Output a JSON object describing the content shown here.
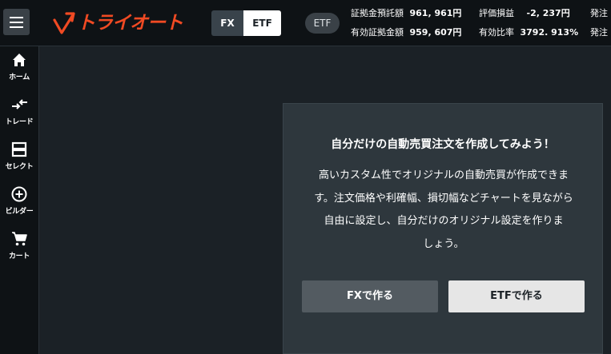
{
  "header": {
    "logo_text": "トライオート",
    "segment": {
      "fx_label": "FX",
      "etf_label": "ETF",
      "selected": "ETF"
    },
    "mode_pill": "ETF",
    "stats": {
      "row1": [
        {
          "label": "証拠金預託額",
          "value": "961, 961円"
        },
        {
          "label": "評価損益",
          "value": "-2, 237円"
        },
        {
          "label": "発注",
          "value": ""
        }
      ],
      "row2": [
        {
          "label": "有効証拠金額",
          "value": "959, 607円"
        },
        {
          "label": "有効比率",
          "value": "3792. 913%"
        },
        {
          "label": "発注",
          "value": ""
        }
      ]
    }
  },
  "sidebar": {
    "items": [
      {
        "label": "ホーム",
        "icon": "home-icon"
      },
      {
        "label": "トレード",
        "icon": "trade-arrows-icon"
      },
      {
        "label": "セレクト",
        "icon": "select-icon"
      },
      {
        "label": "ビルダー",
        "icon": "plus-circle-icon"
      },
      {
        "label": "カート",
        "icon": "cart-icon"
      }
    ]
  },
  "card": {
    "title": "自分だけの自動売買注文を作成してみよう！",
    "body_lines": [
      "高いカスタム性でオリジナルの自動売買が作成できま",
      "す。注文価格や利確幅、損切幅などチャートを見ながら",
      "自由に設定し、自分だけのオリジナル設定を作りま",
      "しょう。"
    ],
    "fx_button": "FXで作る",
    "etf_button": "ETFで作る"
  },
  "colors": {
    "brand": "#f04a23",
    "header_bg": "#0e1215",
    "page_bg": "#1b2126",
    "card_bg": "#2e373d",
    "fx_button_bg": "#535b61",
    "etf_button_bg": "#e6e6e6"
  }
}
